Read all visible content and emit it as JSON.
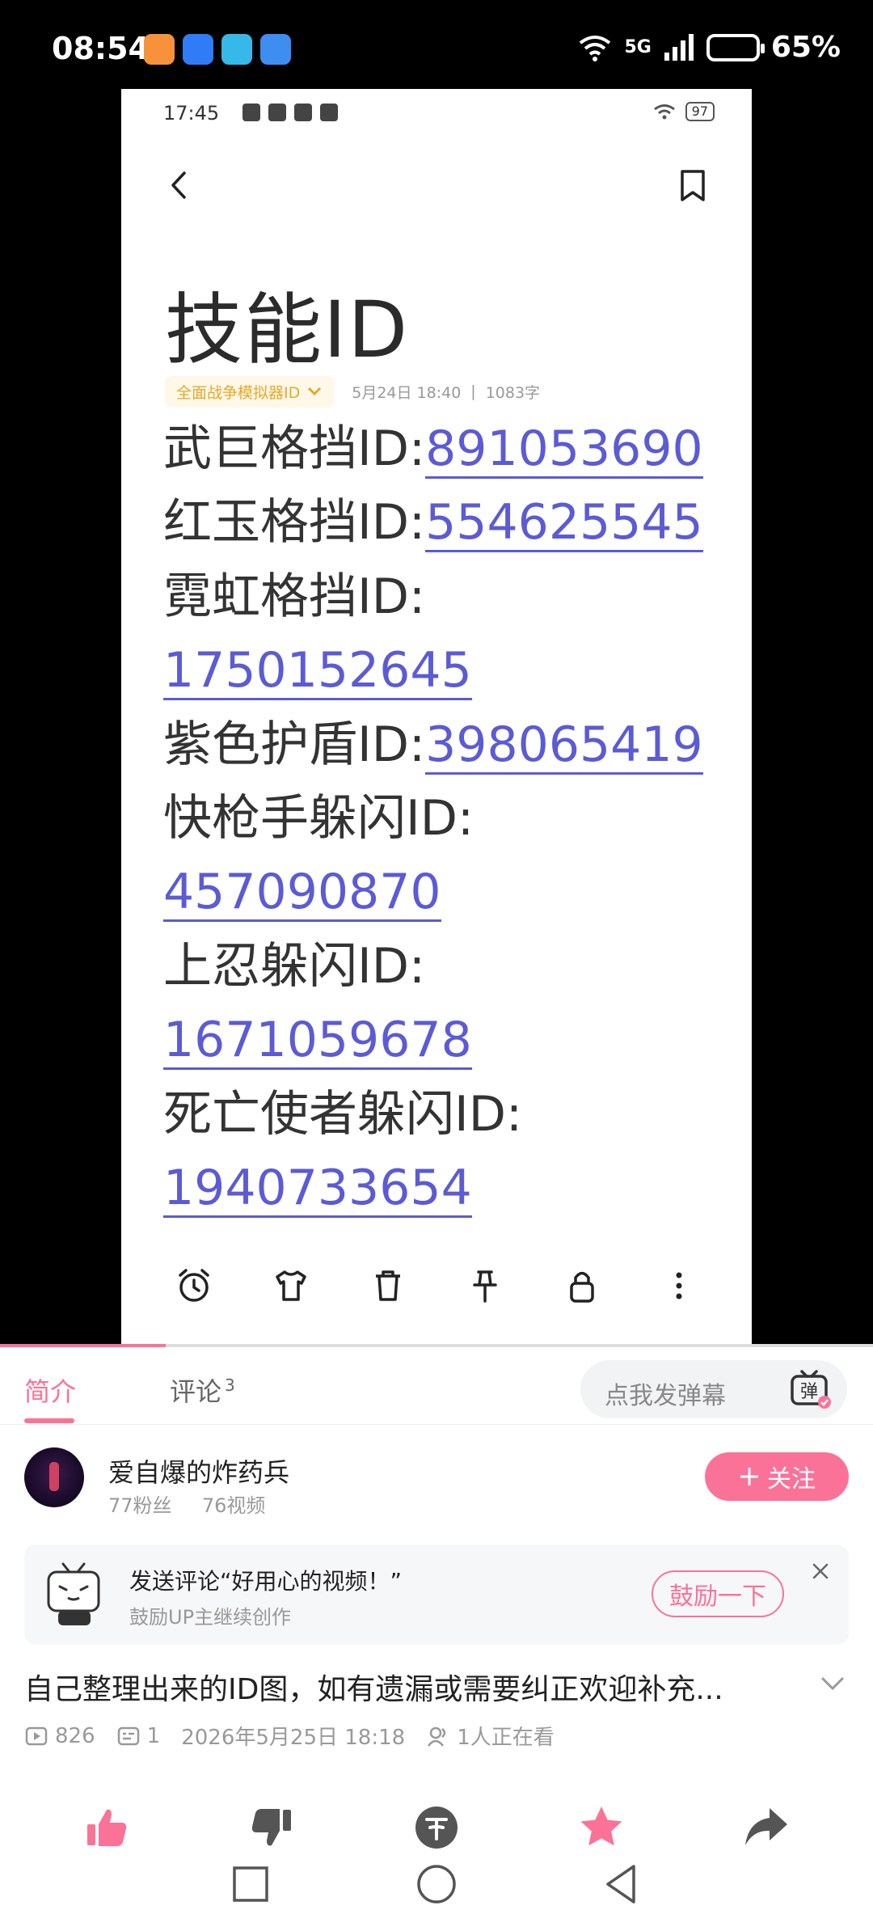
{
  "status_bar": {
    "time": "08:54",
    "network": "5G",
    "battery": "65%"
  },
  "video_frame": {
    "inner_status": {
      "time": "17:45",
      "battery": "97"
    },
    "note": {
      "title": "技能ID",
      "folder": "全面战争模拟器ID",
      "date": "5月24日 18:40",
      "separator": "|",
      "word_count": "1083字",
      "lines": [
        {
          "label": "武巨格挡ID:",
          "id": "891053690",
          "break": false
        },
        {
          "label": "红玉格挡ID:",
          "id": "554625545",
          "break": false
        },
        {
          "label": "霓虹格挡ID:",
          "id": "1750152645",
          "break": true
        },
        {
          "label": "紫色护盾ID:",
          "id": "398065419",
          "break": false
        },
        {
          "label": "快枪手躲闪ID:",
          "id": "457090870",
          "break": true
        },
        {
          "label": "上忍躲闪ID:",
          "id": "1671059678",
          "break": true
        },
        {
          "label": "死亡使者躲闪ID:",
          "id": "1940733654",
          "break": true
        }
      ]
    }
  },
  "playback": {
    "progress": 0.19
  },
  "tabs": {
    "intro": "简介",
    "comments": "评论",
    "comments_count": "3",
    "danmaku_placeholder": "点我发弹幕"
  },
  "uploader": {
    "name": "爱自爆的炸药兵",
    "followers": "77粉丝",
    "videos": "76视频",
    "follow_label": "关注"
  },
  "encourage": {
    "title": "发送评论“好用心的视频！”",
    "subtitle": "鼓励UP主继续创作",
    "button": "鼓励一下"
  },
  "video": {
    "title": "自己整理出来的ID图，如有遗漏或需要纠正欢迎补充...",
    "views": "826",
    "danmaku_count": "1",
    "date": "2026年5月25日 18:18",
    "watching": "1人正在看"
  },
  "colors": {
    "accent": "#fb7299",
    "link": "#5b5bd6"
  }
}
